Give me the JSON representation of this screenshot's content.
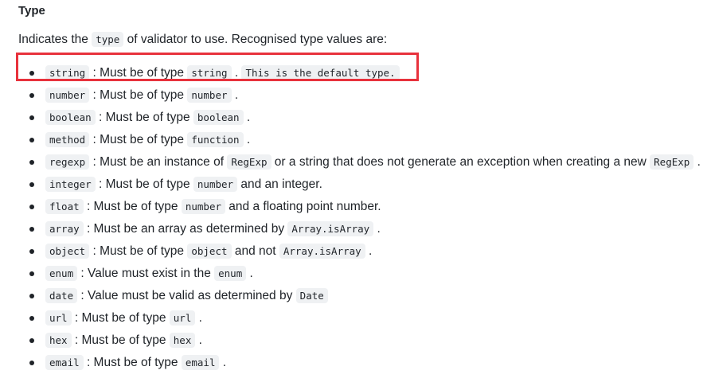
{
  "heading": "Type",
  "intro": {
    "before": "Indicates the",
    "code": "type",
    "after": "of validator to use. Recognised type values are:"
  },
  "rules": [
    {
      "name": "string",
      "parts": [
        {
          "t": " : Must be of type "
        },
        {
          "c": "string"
        },
        {
          "t": " . "
        },
        {
          "c": "This is the default type."
        }
      ]
    },
    {
      "name": "number",
      "parts": [
        {
          "t": " : Must be of type "
        },
        {
          "c": "number"
        },
        {
          "t": " ."
        }
      ]
    },
    {
      "name": "boolean",
      "parts": [
        {
          "t": " : Must be of type "
        },
        {
          "c": "boolean"
        },
        {
          "t": " ."
        }
      ]
    },
    {
      "name": "method",
      "parts": [
        {
          "t": " : Must be of type "
        },
        {
          "c": "function"
        },
        {
          "t": " ."
        }
      ]
    },
    {
      "name": "regexp",
      "parts": [
        {
          "t": " : Must be an instance of "
        },
        {
          "c": "RegExp"
        },
        {
          "t": " or a string that does not generate an exception when creating a new "
        },
        {
          "c": "RegExp"
        },
        {
          "t": " ."
        }
      ]
    },
    {
      "name": "integer",
      "parts": [
        {
          "t": " : Must be of type "
        },
        {
          "c": "number"
        },
        {
          "t": " and an integer."
        }
      ]
    },
    {
      "name": "float",
      "parts": [
        {
          "t": " : Must be of type "
        },
        {
          "c": "number"
        },
        {
          "t": " and a floating point number."
        }
      ]
    },
    {
      "name": "array",
      "parts": [
        {
          "t": " : Must be an array as determined by "
        },
        {
          "c": "Array.isArray"
        },
        {
          "t": " ."
        }
      ]
    },
    {
      "name": "object",
      "parts": [
        {
          "t": " : Must be of type "
        },
        {
          "c": "object"
        },
        {
          "t": " and not "
        },
        {
          "c": "Array.isArray"
        },
        {
          "t": " ."
        }
      ]
    },
    {
      "name": "enum",
      "parts": [
        {
          "t": " : Value must exist in the "
        },
        {
          "c": "enum"
        },
        {
          "t": " ."
        }
      ]
    },
    {
      "name": "date",
      "parts": [
        {
          "t": " : Value must be valid as determined by "
        },
        {
          "c": "Date"
        }
      ]
    },
    {
      "name": "url",
      "parts": [
        {
          "t": " : Must be of type "
        },
        {
          "c": "url"
        },
        {
          "t": " ."
        }
      ]
    },
    {
      "name": "hex",
      "parts": [
        {
          "t": " : Must be of type "
        },
        {
          "c": "hex"
        },
        {
          "t": " ."
        }
      ]
    },
    {
      "name": "email",
      "parts": [
        {
          "t": " : Must be of type "
        },
        {
          "c": "email"
        },
        {
          "t": " ."
        }
      ]
    }
  ],
  "colors": {
    "text": "#1f2328",
    "code_bg": "#eff1f3",
    "highlight": "#e8323c"
  }
}
